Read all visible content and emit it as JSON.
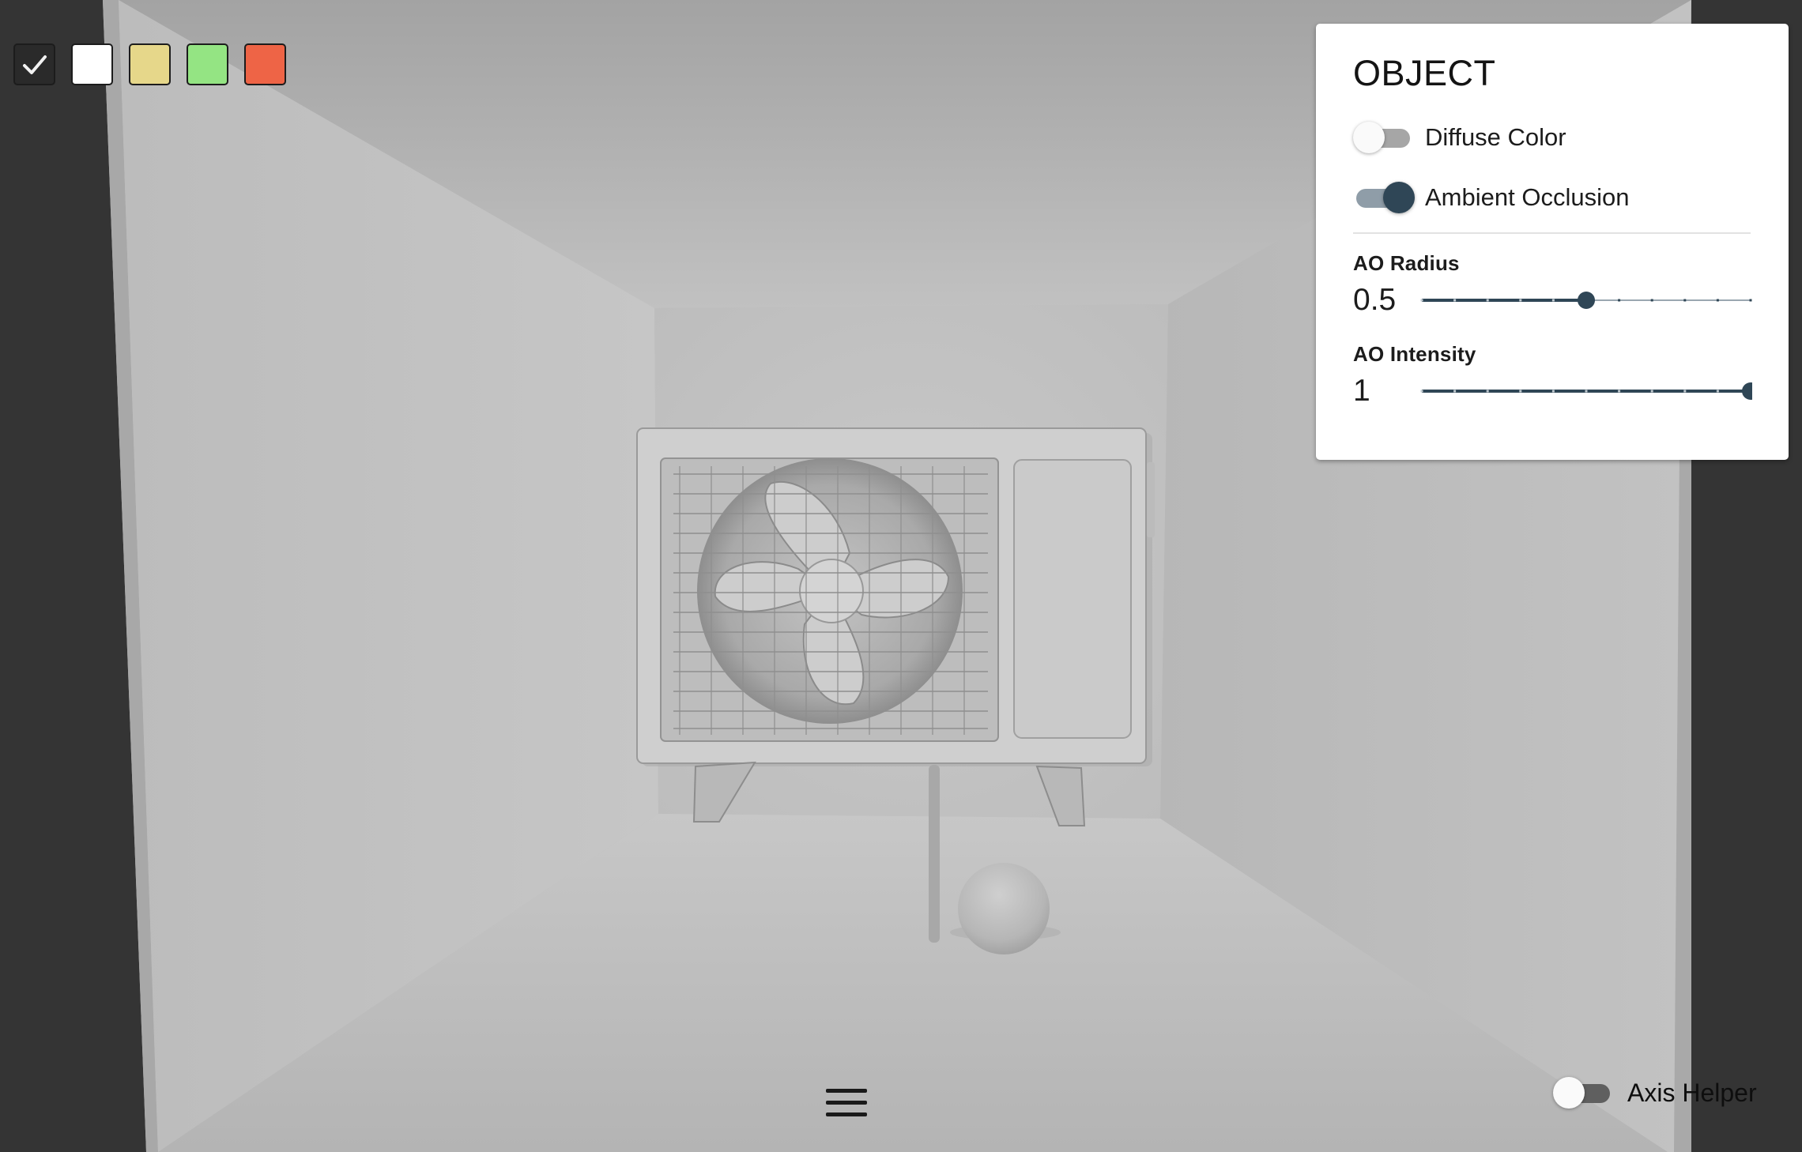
{
  "swatches": [
    {
      "name": "none",
      "color": "#2a2a2a",
      "selected": true,
      "icon": "check-icon"
    },
    {
      "name": "white",
      "color": "#ffffff",
      "selected": false
    },
    {
      "name": "yellow",
      "color": "#e6d78a",
      "selected": false
    },
    {
      "name": "green",
      "color": "#94e483",
      "selected": false
    },
    {
      "name": "red",
      "color": "#ee6446",
      "selected": false
    }
  ],
  "panel": {
    "title": "OBJECT",
    "toggles": [
      {
        "label": "Diffuse Color",
        "on": false
      },
      {
        "label": "Ambient Occlusion",
        "on": true
      }
    ],
    "sliders": [
      {
        "label": "AO Radius",
        "value_text": "0.5",
        "fraction": 0.5,
        "steps": 10
      },
      {
        "label": "AO Intensity",
        "value_text": "1",
        "fraction": 1.0,
        "steps": 10
      }
    ]
  },
  "bottom": {
    "menu_icon": "hamburger-menu-icon",
    "axis_helper": {
      "label": "Axis Helper",
      "on": false
    }
  },
  "colors": {
    "accent": "#2f4656",
    "accent_track": "#8f9da8",
    "background": "#343434"
  }
}
